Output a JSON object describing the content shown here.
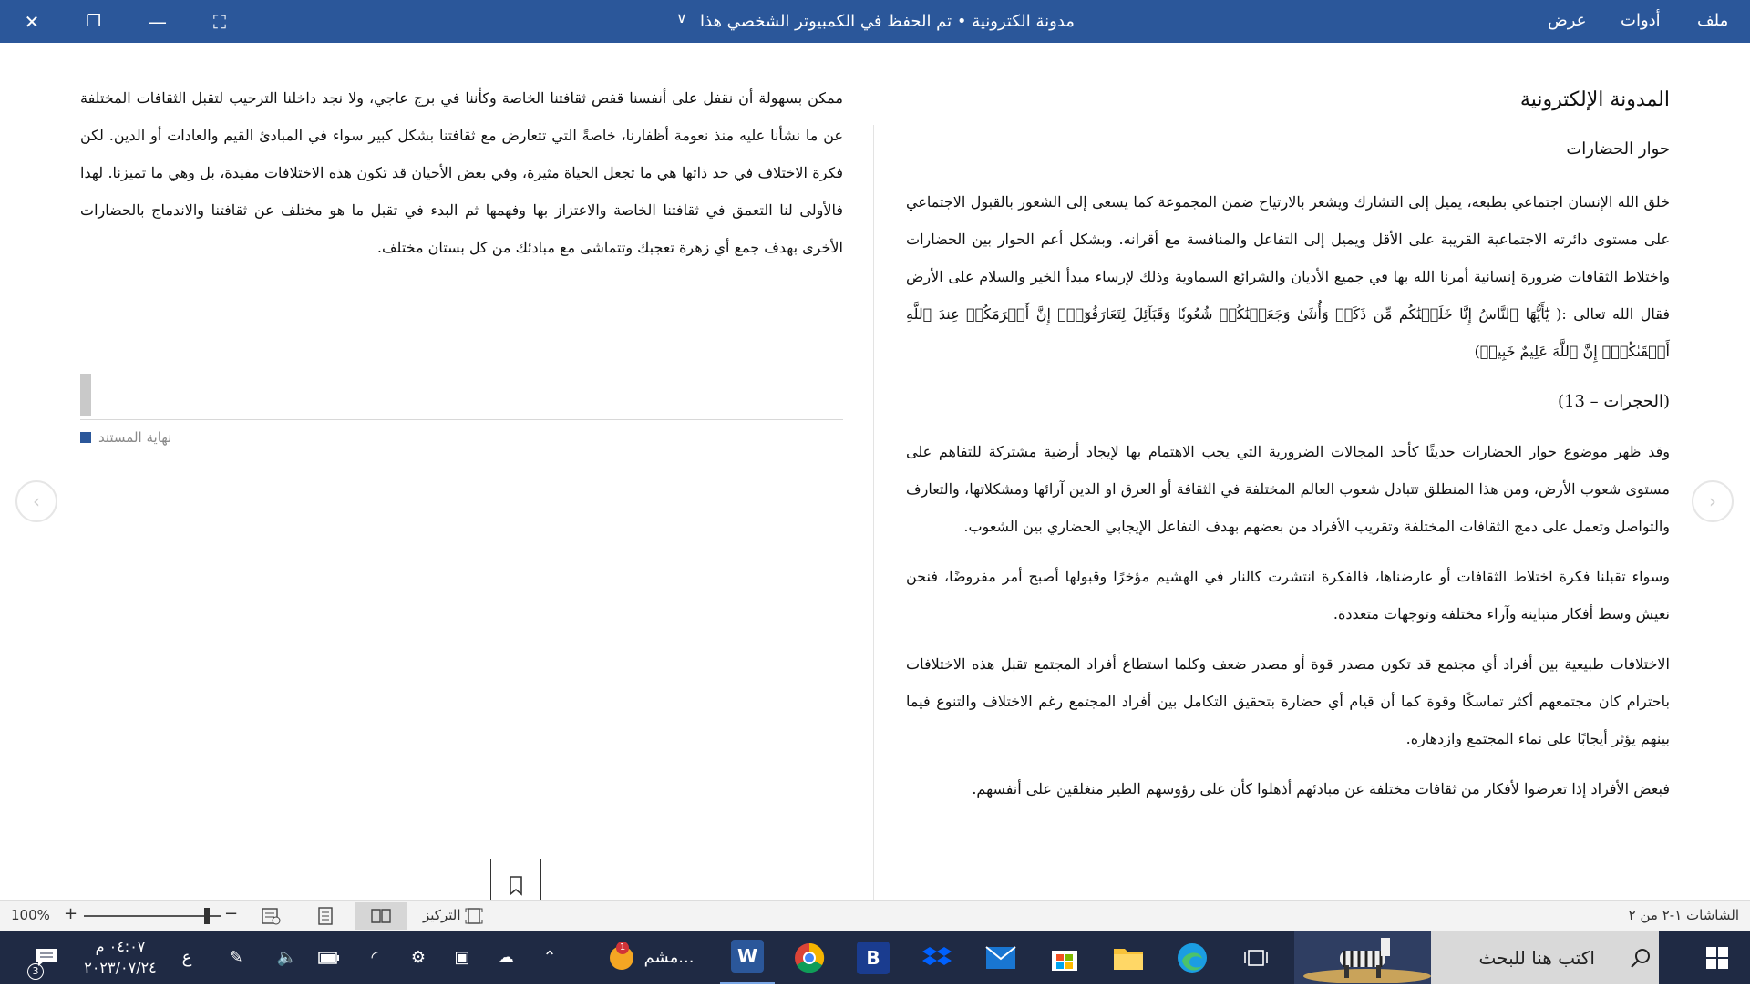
{
  "titlebar": {
    "title": "مدونة الكترونية • تم الحفظ في الكمبيوتر الشخصي هذا",
    "menu": [
      "ملف",
      "أدوات",
      "عرض"
    ],
    "close_glyph": "✕",
    "restore_glyph": "❐",
    "minimize_glyph": "—",
    "fullscreen_glyph": "⛶",
    "chevron_glyph": "∨"
  },
  "document": {
    "heading": "المدونة الإلكترونية",
    "subheading": "حوار الحضارات",
    "right_paragraphs": [
      "خلق الله الإنسان اجتماعي بطبعه، يميل إلى التشارك ويشعر بالارتياح ضمن المجموعة كما يسعى إلى الشعور بالقبول الاجتماعي على مستوى دائرته الاجتماعية القريبة على الأقل ويميل إلى التفاعل والمنافسة مع أقرانه. وبشكل أعم الحوار بين الحضارات واختلاط الثقافات ضرورة إنسانية أمرنا الله بها في جميع الأديان والشرائع السماوية وذلك لإرساء مبدأ الخير والسلام على الأرض فقال الله تعالى :( يَٰٓأَيُّهَا ٱلنَّاسُ إِنَّا خَلَقۡنَٰكُم مِّن ذَكَرٖ وَأُنثَىٰ وَجَعَلۡنَٰكُمۡ شُعُوبٗا وَقَبَآئِلَ لِتَعَارَفُوٓاْۚ إِنَّ أَكۡرَمَكُمۡ عِندَ ٱللَّهِ أَتۡقَىٰكُمۡۚ إِنَّ ٱللَّهَ عَلِيمٌ خَبِيرٞ)",
      "(الحجرات – 13)",
      "وقد ظهر موضوع حوار الحضارات حديثًا كأحد المجالات الضرورية التي يجب الاهتمام بها لإيجاد أرضية مشتركة للتفاهم على مستوى شعوب الأرض، ومن هذا المنطلق تتبادل شعوب العالم المختلفة في الثقافة أو العرق او الدين آرائها ومشكلاتها، والتعارف والتواصل وتعمل على دمج الثقافات المختلفة وتقريب الأفراد من بعضهم بهدف التفاعل الإيجابي الحضاري بين الشعوب.",
      "وسواء تقبلنا فكرة اختلاط الثقافات أو عارضناها، فالفكرة انتشرت كالنار في الهشيم مؤخرًا وقبولها أصبح أمر مفروضًا، فنحن نعيش وسط أفكار متباينة وآراء مختلفة وتوجهات متعددة.",
      "الاختلافات طبيعية بين أفراد أي مجتمع قد تكون مصدر قوة أو مصدر ضعف وكلما استطاع أفراد المجتمع تقبل هذه الاختلافات باحترام كان مجتمعهم أكثر تماسكًا وقوة كما أن قيام أي حضارة بتحقيق التكامل بين أفراد المجتمع رغم الاختلاف والتنوع فيما بينهم يؤثر أيجابًا على نماء المجتمع وازدهاره.",
      "فبعض الأفراد إذا تعرضوا لأفكار من ثقافات مختلفة عن مبادئهم أذهلوا كأن على رؤوسهم الطير منغلقين على أنفسهم."
    ],
    "left_paragraph": "ممكن بسهولة أن نقفل على أنفسنا قفص ثقافتنا الخاصة وكأننا في برج عاجي، ولا نجد داخلنا الترحيب لتقبل الثقافات المختلفة عن ما نشأنا عليه منذ نعومة أظفارنا، خاصةً التي تتعارض مع ثقافتنا بشكل كبير سواء في المبادئ القيم والعادات أو الدين. لكن فكرة الاختلاف في حد ذاتها هي ما تجعل الحياة مثيرة، وفي بعض الأحيان قد تكون هذه الاختلافات مفيدة، بل وهي ما تميزنا. لهذا فالأولى لنا التعمق في ثقافتنا الخاصة والاعتزاز بها وفهمها ثم البدء في تقبل ما هو مختلف عن ثقافتنا والاندماج بالحضارات الأخرى بهدف جمع أي زهرة تعجبك وتتماشى مع مبادئك من كل بستان مختلف.",
    "end_label": "نهاية المستند"
  },
  "nav": {
    "prev_glyph": "‹",
    "next_glyph": "›"
  },
  "statusbar": {
    "pages": "الشاشات ١-٢ من ٢",
    "focus_label": "التركيز",
    "zoom": "100%",
    "zoom_plus": "+",
    "zoom_minus": "−",
    "zoom_level": 0.9
  },
  "taskbar": {
    "search_placeholder": "اكتب هنا للبحث",
    "weather_label": "مشم...",
    "weather_badge": "1",
    "time": "٠٤:٠٧ م",
    "date": "٢٠٢٣/٠٧/٢٤",
    "lang": "ع",
    "notif_count": "3",
    "colors": {
      "taskbar": "#1f2a44",
      "titlebar": "#2b579a"
    }
  }
}
